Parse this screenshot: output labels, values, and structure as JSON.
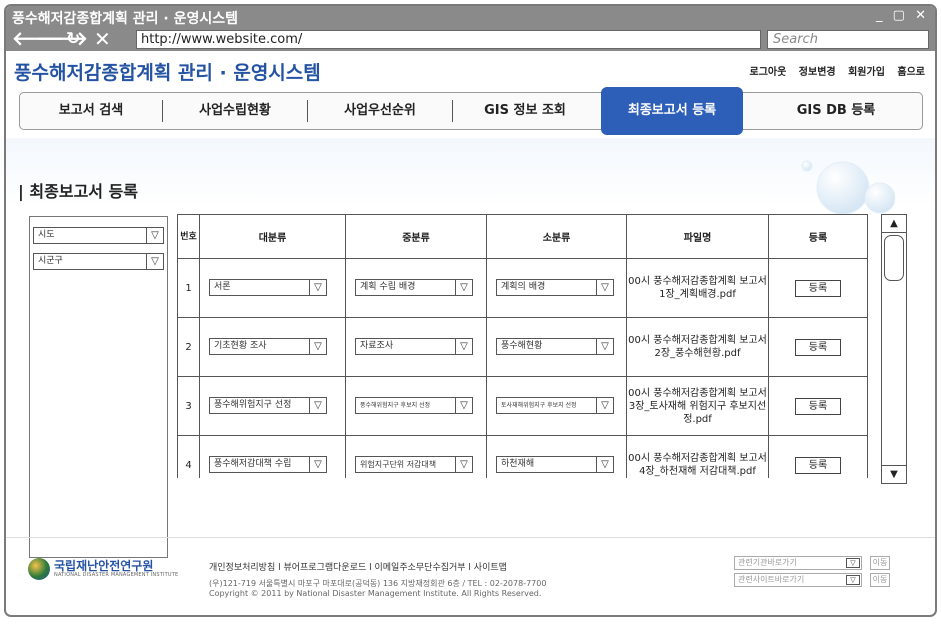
{
  "window": {
    "title": "풍수해저감종합계획 관리 · 운영시스템",
    "controls": "_ ▢ ✕",
    "url": "http://www.website.com/",
    "search_placeholder": "Search"
  },
  "site": {
    "title": "풍수해저감종합계획 관리 · 운영시스템",
    "links": [
      "로그아웃",
      "정보변경",
      "회원가입",
      "홈으로"
    ]
  },
  "tabs": [
    "보고서 검색",
    "사업수립현황",
    "사업우선순위",
    "GIS 정보 조회",
    "최종보고서 등록",
    "GIS DB 등록"
  ],
  "active_tab": "최종보고서 등록",
  "section_title": "| 최종보고서 등록",
  "filters": [
    {
      "label": "시도",
      "value": "시도"
    },
    {
      "label": "시군구",
      "value": "시군구"
    }
  ],
  "table": {
    "headers": [
      "번호",
      "대분류",
      "중분류",
      "소분류",
      "파일명",
      "등록"
    ],
    "rows": [
      {
        "num": "1",
        "major": "서론",
        "middle": "계획 수립 배경",
        "minor": "계획의 배경",
        "file": "00시 풍수해저감종합계획 보고서 1장_계획배경.pdf",
        "action": "등록"
      },
      {
        "num": "2",
        "major": "기초현황 조사",
        "middle": "자료조사",
        "minor": "풍수해현황",
        "file": "00시 풍수해저감종합계획 보고서 2장_풍수해현황.pdf",
        "action": "등록"
      },
      {
        "num": "3",
        "major": "풍수해위험지구 선정",
        "middle": "풍수해위험지구 후보지 선정",
        "minor": "토사재해위험지구 후보지 선정",
        "file": "00시 풍수해저감종합계획 보고서 3장_토사재해 위험지구 후보지선정.pdf",
        "action": "등록"
      },
      {
        "num": "4",
        "major": "풍수해저감대책 수립",
        "middle": "위험지구단위 저감대책",
        "minor": "하천재해",
        "file": "00시 풍수해저감종합계획 보고서 4장_하천재해 저감대책.pdf",
        "action": "등록"
      }
    ]
  },
  "footer": {
    "org_name": "국립재난안전연구원",
    "org_sub": "NATIONAL DISASTER MANAGEMENT INSTITUTE",
    "links": "개인정보처리방침 l 뷰어프로그램다운로드 l 이메일주소무단수집거부 l 사이트맵",
    "address": "(우)121-719 서울특별시 마포구 마포대로(공덕동) 136 지방재정회관 6층 / TEL : 02-2078-7700",
    "copyright": "Copyright © 2011 by National Disaster Management Institute. All Rights Reserved.",
    "select1": "관련기관바로가기",
    "select2": "관련사이트바로가기",
    "go_label": "이동"
  },
  "colors": {
    "accent": "#2e5fb8",
    "title_blue": "#2553a3",
    "chrome_gray": "#8a8a8a"
  }
}
